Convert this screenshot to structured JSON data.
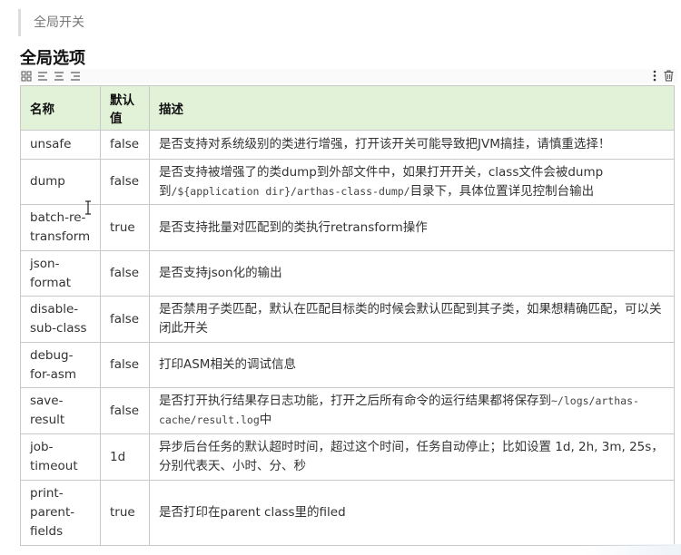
{
  "quote": "全局开关",
  "heading": "全局选项",
  "toolbar": {
    "left_icons": [
      "grid-icon",
      "align-left-icon",
      "align-center-icon",
      "align-right-icon"
    ],
    "right_icons": [
      "more-icon",
      "trash-icon"
    ]
  },
  "table": {
    "headers": [
      "名称",
      "默认值",
      "描述"
    ],
    "rows": [
      {
        "name": "unsafe",
        "default": "false",
        "desc": "是否支持对系统级别的类进行增强，打开该开关可能导致把JVM搞挂，请慎重选择！"
      },
      {
        "name": "dump",
        "default": "false",
        "desc_a": "是否支持被增强了的类dump到外部文件中，如果打开开关，class文件会被dump到",
        "desc_code": "/${application dir}/arthas-class-dump/",
        "desc_b": "目录下，具体位置详见控制台输出"
      },
      {
        "name": "batch-re-transform",
        "default": "true",
        "desc": "是否支持批量对匹配到的类执行retransform操作"
      },
      {
        "name": "json-format",
        "default": "false",
        "desc": "是否支持json化的输出"
      },
      {
        "name": "disable-sub-class",
        "default": "false",
        "desc": "是否禁用子类匹配，默认在匹配目标类的时候会默认匹配到其子类，如果想精确匹配，可以关闭此开关"
      },
      {
        "name": "debug-for-asm",
        "default": "false",
        "desc": "打印ASM相关的调试信息"
      },
      {
        "name": "save-result",
        "default": "false",
        "desc_a": "是否打开执行结果存日志功能，打开之后所有命令的运行结果都将保存到",
        "desc_code": "~/logs/arthas-cache/result.log",
        "desc_b": "中"
      },
      {
        "name": "job-timeout",
        "default": "1d",
        "desc": "异步后台任务的默认超时时间，超过这个时间，任务自动停止；比如设置 1d, 2h, 3m, 25s，分别代表天、小时、分、秒"
      },
      {
        "name": "print-parent-fields",
        "default": "true",
        "desc": "是否打印在parent class里的filed"
      }
    ]
  },
  "colors": {
    "header_bg": "#e2f2d9",
    "border": "#c8c8c8"
  }
}
